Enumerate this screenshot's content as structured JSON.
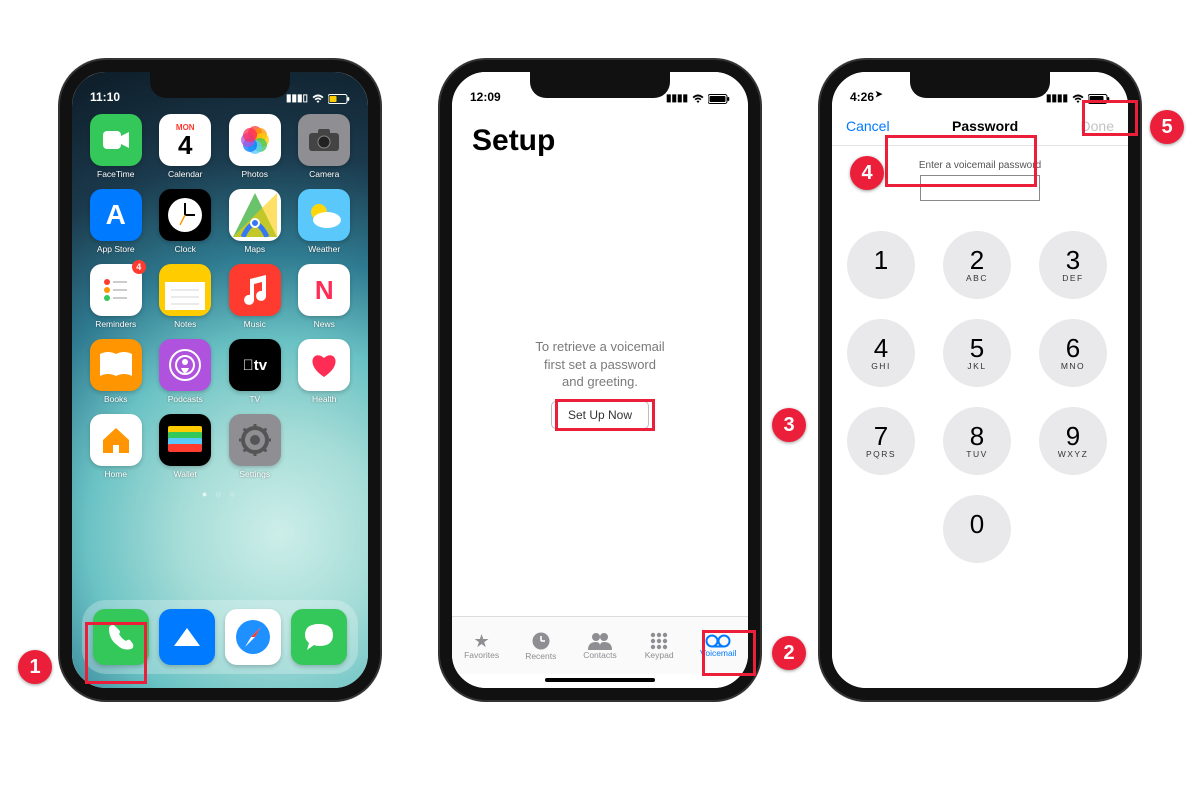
{
  "callouts": {
    "c1": "1",
    "c2": "2",
    "c3": "3",
    "c4": "4",
    "c5": "5"
  },
  "phone1": {
    "time": "11:10",
    "apps": [
      {
        "label": "FaceTime",
        "bg": "bg-green",
        "glyph": "video"
      },
      {
        "label": "Calendar",
        "bg": "bg-white",
        "glyph": "cal",
        "day": "MON",
        "date": "4"
      },
      {
        "label": "Photos",
        "bg": "bg-white",
        "glyph": "photos"
      },
      {
        "label": "Camera",
        "bg": "bg-grey",
        "glyph": "camera"
      },
      {
        "label": "App Store",
        "bg": "bg-blue",
        "glyph": "A"
      },
      {
        "label": "Clock",
        "bg": "bg-black",
        "glyph": "clock"
      },
      {
        "label": "Maps",
        "bg": "bg-white",
        "glyph": "maps"
      },
      {
        "label": "Weather",
        "bg": "bg-lblue",
        "glyph": "weather"
      },
      {
        "label": "Reminders",
        "bg": "bg-white",
        "glyph": "reminders",
        "badge": "4"
      },
      {
        "label": "Notes",
        "bg": "bg-yellow",
        "glyph": "notes"
      },
      {
        "label": "Music",
        "bg": "bg-red",
        "glyph": "music"
      },
      {
        "label": "News",
        "bg": "bg-white",
        "glyph": "N"
      },
      {
        "label": "Books",
        "bg": "bg-orange",
        "glyph": "books"
      },
      {
        "label": "Podcasts",
        "bg": "bg-purple",
        "glyph": "podcasts"
      },
      {
        "label": "TV",
        "bg": "bg-black",
        "glyph": "tv"
      },
      {
        "label": "Health",
        "bg": "bg-white",
        "glyph": "health"
      },
      {
        "label": "Home",
        "bg": "bg-white",
        "glyph": "home"
      },
      {
        "label": "Wallet",
        "bg": "bg-black",
        "glyph": "wallet"
      },
      {
        "label": "Settings",
        "bg": "bg-grey",
        "glyph": "settings"
      }
    ],
    "dock": [
      {
        "label": "Phone",
        "bg": "bg-green",
        "glyph": "phone"
      },
      {
        "label": "Mail",
        "bg": "bg-blue",
        "glyph": "mail"
      },
      {
        "label": "Safari",
        "bg": "bg-white",
        "glyph": "safari"
      },
      {
        "label": "Messages",
        "bg": "bg-green",
        "glyph": "messages"
      }
    ]
  },
  "phone2": {
    "time": "12:09",
    "title": "Setup",
    "msg_l1": "To retrieve a voicemail",
    "msg_l2": "first set a password",
    "msg_l3": "and greeting.",
    "btn": "Set Up Now",
    "tabs": [
      {
        "label": "Favorites",
        "glyph": "★"
      },
      {
        "label": "Recents",
        "glyph": "clock"
      },
      {
        "label": "Contacts",
        "glyph": "contacts"
      },
      {
        "label": "Keypad",
        "glyph": "keypad"
      },
      {
        "label": "Voicemail",
        "glyph": "vm",
        "active": true
      }
    ]
  },
  "phone3": {
    "time": "4:26",
    "nav": {
      "cancel": "Cancel",
      "title": "Password",
      "done": "Done"
    },
    "pw_label": "Enter a voicemail password",
    "keys": [
      {
        "n": "1",
        "l": ""
      },
      {
        "n": "2",
        "l": "ABC"
      },
      {
        "n": "3",
        "l": "DEF"
      },
      {
        "n": "4",
        "l": "GHI"
      },
      {
        "n": "5",
        "l": "JKL"
      },
      {
        "n": "6",
        "l": "MNO"
      },
      {
        "n": "7",
        "l": "PQRS"
      },
      {
        "n": "8",
        "l": "TUV"
      },
      {
        "n": "9",
        "l": "WXYZ"
      },
      {
        "n": "0",
        "l": "",
        "zero": true
      }
    ]
  }
}
